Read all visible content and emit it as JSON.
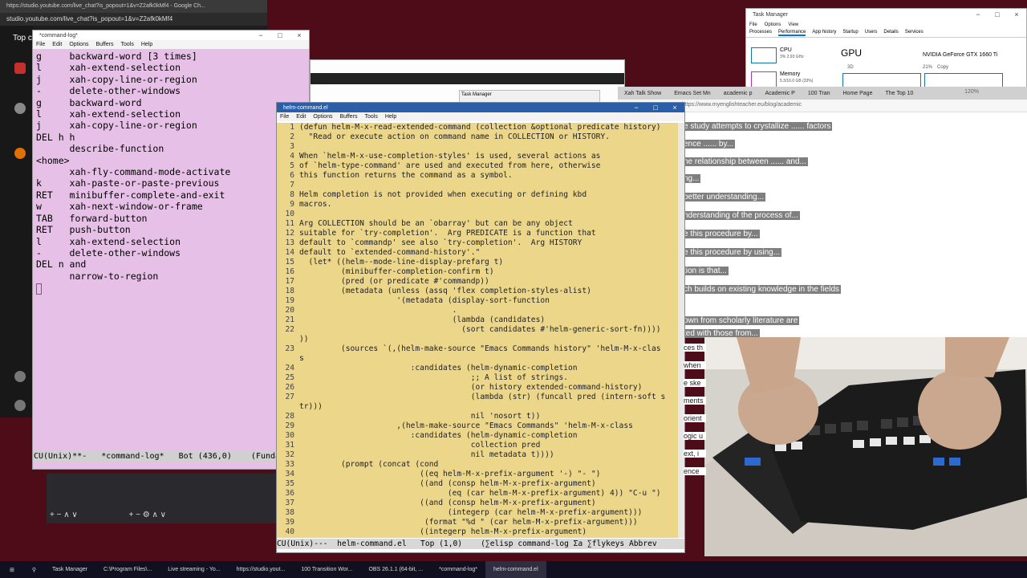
{
  "yt": {
    "title": "https://studio.youtube.com/live_chat?is_popout=1&v=Z2afk0kMf4 - Google Ch...",
    "url": "studio.youtube.com/live_chat?is_popout=1&v=Z2afk0kMf4",
    "top_label": "Top c"
  },
  "cmdlog": {
    "title": "*command-log*",
    "menu": [
      "File",
      "Edit",
      "Options",
      "Buffers",
      "Tools",
      "Help"
    ],
    "lines": [
      "g     backward-word [3 times]",
      "l     xah-extend-selection",
      "j     xah-copy-line-or-region",
      "-     delete-other-windows",
      "g     backward-word",
      "l     xah-extend-selection",
      "j     xah-copy-line-or-region",
      "DEL h h",
      "      describe-function",
      "<home>",
      "      xah-fly-command-mode-activate",
      "k     xah-paste-or-paste-previous",
      "RET   minibuffer-complete-and-exit",
      "w     xah-next-window-or-frame",
      "TAB   forward-button",
      "RET   push-button",
      "l     xah-extend-selection",
      "-     delete-other-windows",
      "DEL n and",
      "      narrow-to-region"
    ],
    "modeline": "CU(Unix)**-   *command-log*   Bot (436,0)    (Funda"
  },
  "taskmgr": {
    "title": "Task Manager",
    "menu": [
      "File",
      "Options",
      "View"
    ],
    "tabs": [
      "Processes",
      "Performance",
      "App history",
      "Startup",
      "Users",
      "Details",
      "Services"
    ],
    "cpu_label": "CPU",
    "cpu_value": "3% 2.93 GHz",
    "mem_label": "Memory",
    "mem_value": "5.3/16.0 GB (33%)",
    "gpu_label": "GPU",
    "gpu_name": "NVIDIA GeForce GTX 1660 Ti",
    "gpu_3d": "3D",
    "gpu_copy_pct": "21%",
    "gpu_copy": "Copy"
  },
  "browser": {
    "tabs": [
      "Xah Talk Show",
      "Emacs Set Mn",
      "academic p",
      "Academic P",
      "100 Tran",
      "Home Page",
      "The Top 10"
    ],
    "url": "https://www.myenglishteacher.eu/blog/academic",
    "zoom": "120%",
    "paragraphs": [
      "e study attempts to crystallize ...... factors",
      "ence ...... by...",
      "he relationship between ...... and...",
      "ng...",
      "better understanding...",
      "nderstanding of the process of...",
      "e this procedure by...",
      "e this procedure by using...",
      "tion is that...",
      "ch builds on existing knowledge in the fields",
      "own from scholarly literature are",
      "ted with those from..."
    ],
    "side_fragments": [
      "ces th",
      "when",
      "e ske",
      "ments",
      "orient",
      "ogic u",
      "ext, i",
      "ence"
    ]
  },
  "helm": {
    "title": "helm-command.el",
    "menu": [
      "File",
      "Edit",
      "Options",
      "Buffers",
      "Tools",
      "Help"
    ],
    "modeline": "CU(Unix)---  helm-command.el   Top (1,0)    (∑elisp command-log Σa ∑flykeys Abbrev",
    "lines": [
      "(defun helm-M-x-read-extended-command (collection &optional predicate history)",
      "  \"Read or execute action on command name in COLLECTION or HISTORY.",
      "",
      "When `helm-M-x-use-completion-styles' is used, several actions as",
      "of `helm-type-command' are used and executed from here, otherwise",
      "this function returns the command as a symbol.",
      "",
      "Helm completion is not provided when executing or defining kbd",
      "macros.",
      "",
      "Arg COLLECTION should be an `obarray' but can be any object",
      "suitable for `try-completion'.  Arg PREDICATE is a function that",
      "default to `commandp' see also `try-completion'.  Arg HISTORY",
      "default to `extended-command-history'.\"",
      "  (let* ((helm--mode-line-display-prefarg t)",
      "         (minibuffer-completion-confirm t)",
      "         (pred (or predicate #'commandp))",
      "         (metadata (unless (assq 'flex completion-styles-alist)",
      "                     '(metadata (display-sort-function",
      "                                 .",
      "                                 (lambda (candidates)",
      "                                   (sort candidates #'helm-generic-sort-fn))))",
      "))",
      "         (sources `(,(helm-make-source \"Emacs Commands history\" 'helm-M-x-clas",
      "s",
      "                        :candidates (helm-dynamic-completion",
      "                                     ;; A list of strings.",
      "                                     (or history extended-command-history)",
      "                                     (lambda (str) (funcall pred (intern-soft s",
      "tr)))",
      "                                     nil 'nosort t))",
      "                     ,(helm-make-source \"Emacs Commands\" 'helm-M-x-class",
      "                        :candidates (helm-dynamic-completion",
      "                                     collection pred",
      "                                     nil metadata t))))",
      "         (prompt (concat (cond",
      "                          ((eq helm-M-x-prefix-argument '-) \"- \")",
      "                          ((and (consp helm-M-x-prefix-argument)",
      "                                (eq (car helm-M-x-prefix-argument) 4)) \"C-u \")",
      "                          ((and (consp helm-M-x-prefix-argument)",
      "                                (integerp (car helm-M-x-prefix-argument)))",
      "                           (format \"%d \" (car helm-M-x-prefix-argument)))",
      "                          ((integerp helm-M-x-prefix-argument)"
    ],
    "line_numbers": [
      "1",
      "2",
      "3",
      "4",
      "5",
      "6",
      "7",
      "8",
      "9",
      "10",
      "11",
      "12",
      "13",
      "14",
      "15",
      "16",
      "17",
      "18",
      "19",
      "20",
      "21",
      "22",
      "",
      "23",
      "",
      "24",
      "25",
      "26",
      "27",
      "",
      "28",
      "29",
      "30",
      "31",
      "32",
      "33",
      "34",
      "35",
      "36",
      "37",
      "38",
      "39",
      "40"
    ]
  },
  "small_window": {
    "title": "Task Manager"
  },
  "taskbar": {
    "items": [
      "Task Manager",
      "C:\\Program Files\\...",
      "Live streaming - Yo...",
      "https://studio.yout...",
      "100 Transition Wor...",
      "OBS 26.1.1 (64-bit, ...",
      "*command-log*",
      "helm-command.el"
    ]
  }
}
